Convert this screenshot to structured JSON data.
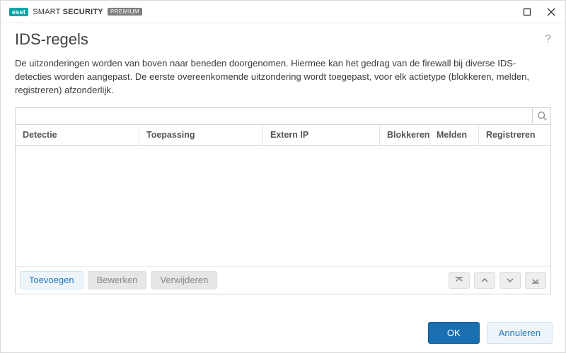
{
  "brand": {
    "badge": "eset",
    "name_light": "SMART",
    "name_bold": "SECURITY",
    "edition": "PREMIUM"
  },
  "page": {
    "title": "IDS-regels",
    "description": "De uitzonderingen worden van boven naar beneden doorgenomen. Hiermee kan het gedrag van de firewall bij diverse IDS-detecties worden aangepast. De eerste overeenkomende uitzondering wordt toegepast, voor elk actietype (blokkeren, melden, registreren) afzonderlijk."
  },
  "search": {
    "placeholder": ""
  },
  "columns": {
    "detect": "Detectie",
    "app": "Toepassing",
    "ip": "Extern IP",
    "block": "Blokkeren",
    "report": "Melden",
    "log": "Registreren"
  },
  "rows": [],
  "actions": {
    "add": "Toevoegen",
    "edit": "Bewerken",
    "delete": "Verwijderen"
  },
  "footer": {
    "ok": "OK",
    "cancel": "Annuleren"
  }
}
